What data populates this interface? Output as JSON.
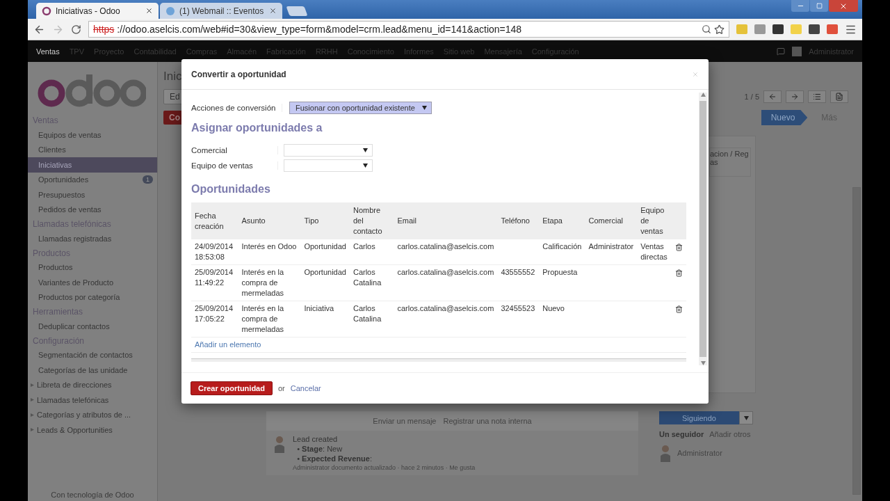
{
  "browser": {
    "tabs": [
      {
        "title": "Iniciativas - Odoo",
        "selected": true,
        "kind": "ring"
      },
      {
        "title": "(1) Webmail :: Eventos",
        "selected": false,
        "kind": "globe"
      }
    ],
    "url_scheme": "https",
    "url_rest": "://odoo.aselcis.com/web#id=30&view_type=form&model=crm.lead&menu_id=141&action=148"
  },
  "top_menu": {
    "items": [
      {
        "label": "Ventas",
        "selected": true
      },
      {
        "label": "TPV",
        "selected": false
      },
      {
        "label": "Proyecto",
        "selected": false
      },
      {
        "label": "Contabilidad",
        "selected": false
      },
      {
        "label": "Compras",
        "selected": false
      },
      {
        "label": "Almacén",
        "selected": false
      },
      {
        "label": "Fabricación",
        "selected": false
      },
      {
        "label": "RRHH",
        "selected": false
      },
      {
        "label": "Conocimiento",
        "selected": false
      },
      {
        "label": "Informes",
        "selected": false
      },
      {
        "label": "Sitio web",
        "selected": false
      },
      {
        "label": "Mensajería",
        "selected": false
      },
      {
        "label": "Configuración",
        "selected": false
      }
    ],
    "user": "Administrator"
  },
  "sidebar": {
    "sections": [
      {
        "title": "Ventas",
        "items": [
          {
            "label": "Equipos de ventas",
            "selected": false,
            "kind": "link"
          },
          {
            "label": "Clientes",
            "selected": false,
            "kind": "link"
          },
          {
            "label": "Iniciativas",
            "selected": true,
            "kind": "link"
          },
          {
            "label": "Oportunidades",
            "selected": false,
            "kind": "link",
            "badge": "1"
          },
          {
            "label": "Presupuestos",
            "selected": false,
            "kind": "link"
          },
          {
            "label": "Pedidos de ventas",
            "selected": false,
            "kind": "link"
          }
        ]
      },
      {
        "title": "Llamadas telefónicas",
        "items": [
          {
            "label": "Llamadas registradas",
            "selected": false,
            "kind": "link"
          }
        ]
      },
      {
        "title": "Productos",
        "items": [
          {
            "label": "Productos",
            "selected": false,
            "kind": "link"
          },
          {
            "label": "Variantes de Producto",
            "selected": false,
            "kind": "link"
          },
          {
            "label": "Productos por categoría",
            "selected": false,
            "kind": "link"
          }
        ]
      },
      {
        "title": "Herramientas",
        "items": [
          {
            "label": "Deduplicar contactos",
            "selected": false,
            "kind": "link"
          }
        ]
      },
      {
        "title": "Configuración",
        "items": [
          {
            "label": "Segmentación de contactos",
            "selected": false,
            "kind": "link"
          },
          {
            "label": "Categorías de las unidade",
            "selected": false,
            "kind": "link"
          },
          {
            "label": "Libreta de direcciones",
            "selected": false,
            "kind": "group",
            "expanded": false
          },
          {
            "label": "Llamadas telefónicas",
            "selected": false,
            "kind": "group",
            "expanded": false
          },
          {
            "label": "Categorías y atributos de ...",
            "selected": false,
            "kind": "group",
            "expanded": false
          },
          {
            "label": "Leads & Opportunities",
            "selected": false,
            "kind": "group",
            "expanded": false
          }
        ]
      }
    ],
    "footer": "Con tecnología de Odoo"
  },
  "record": {
    "title": "Inic",
    "edit_button": "Ed",
    "convert_button": "Co",
    "pager": "1 / 5",
    "stages": [
      {
        "label": "Nuevo",
        "selected": true
      },
      {
        "label": "Más",
        "selected": false
      }
    ],
    "field_fragment": [
      "acion / Reg",
      "as"
    ]
  },
  "chatter": {
    "actions": [
      "Enviar un mensaje",
      "Registrar una nota interna"
    ],
    "message": {
      "title": "Lead created",
      "changes": [
        {
          "bullet": "•",
          "label": "Stage",
          "value": ": New"
        },
        {
          "bullet": "•",
          "label": "Expected Revenue",
          "value": ":"
        }
      ],
      "author": "Administrator",
      "meta": "documento actualizado · hace 2 minutos · Me gusta"
    },
    "follow_button": "Siguiendo",
    "followers_count": "Un seguidor",
    "add_followers": "Añadir otros",
    "followers": [
      {
        "name": "Administrator"
      }
    ]
  },
  "modal": {
    "title": "Convertir a oportunidad",
    "action_label": "Acciones de conversión",
    "action_value": "Fusionar con oportunidad existente",
    "assign_heading": "Asignar oportunidades a",
    "fields": [
      {
        "label": "Comercial"
      },
      {
        "label": "Equipo de ventas"
      }
    ],
    "list_heading": "Oportunidades",
    "columns": [
      "Fecha creación",
      "Asunto",
      "Tipo",
      "Nombre del contacto",
      "Email",
      "Teléfono",
      "Etapa",
      "Comercial",
      "Equipo de ventas"
    ],
    "rows": [
      [
        "24/09/2014 18:53:08",
        "Interés en Odoo",
        "Oportunidad",
        "Carlos",
        "carlos.catalina@aselcis.com",
        "",
        "Calificación",
        "Administrator",
        "Ventas directas"
      ],
      [
        "25/09/2014 11:49:22",
        "Interés en la compra de mermeladas",
        "Oportunidad",
        "Carlos Catalina",
        "carlos.catalina@aselcis.com",
        "43555552",
        "Propuesta",
        "",
        ""
      ],
      [
        "25/09/2014 17:05:22",
        "Interés en la compra de mermeladas",
        "Iniciativa",
        "Carlos Catalina",
        "carlos.catalina@aselcis.com",
        "32455523",
        "Nuevo",
        "",
        ""
      ]
    ],
    "add_link": "Añadir un elemento",
    "primary_button": "Crear oportunidad",
    "or_text": "or",
    "cancel_link": "Cancelar"
  }
}
